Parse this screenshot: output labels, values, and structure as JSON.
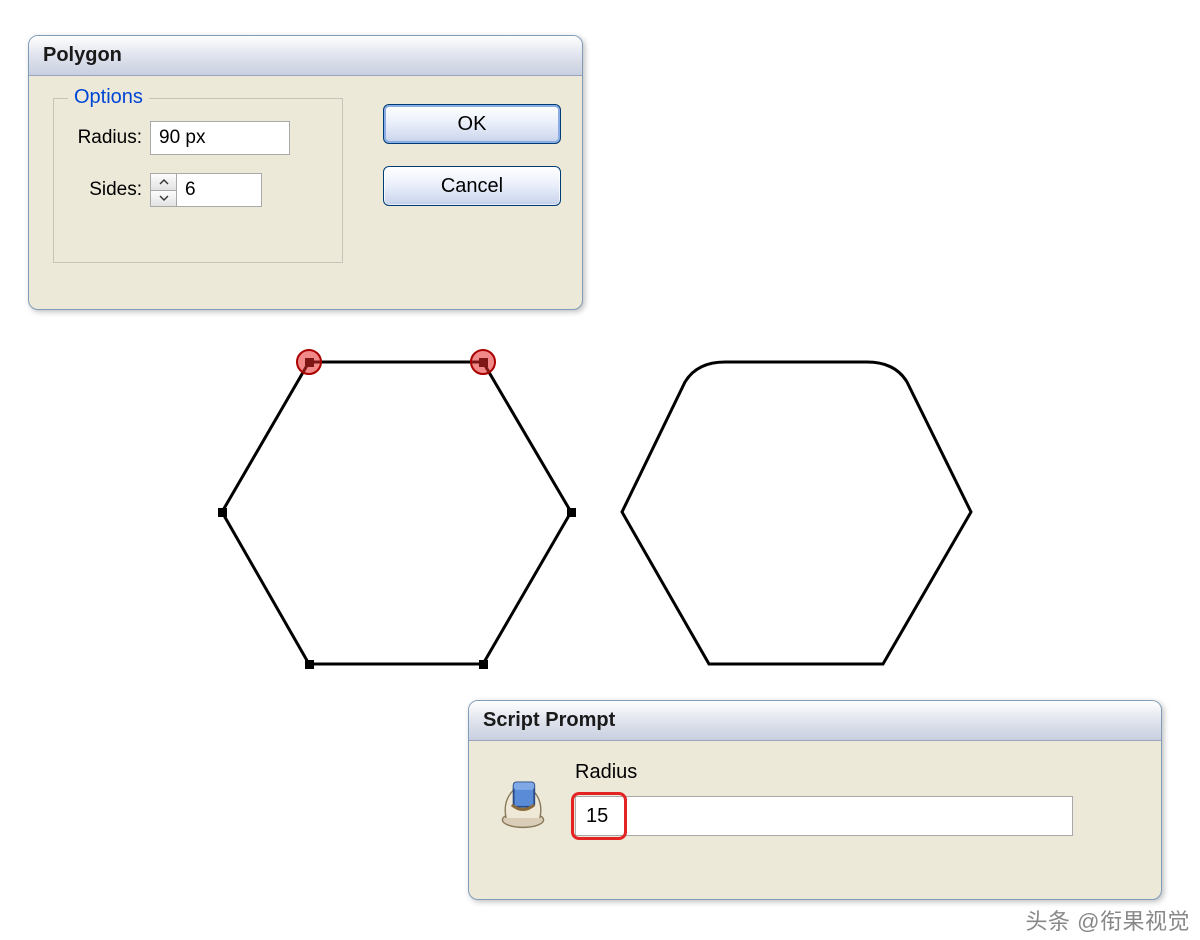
{
  "polygon_dialog": {
    "title": "Polygon",
    "options": {
      "legend": "Options",
      "radius_label": "Radius:",
      "radius_value": "90 px",
      "sides_label": "Sides:",
      "sides_value": "6"
    },
    "buttons": {
      "ok": "OK",
      "cancel": "Cancel"
    }
  },
  "script_dialog": {
    "title": "Script Prompt",
    "field_label": "Radius",
    "field_value": "15",
    "icon": "script-scroll-icon"
  },
  "watermark": "头条 @衔果视觉"
}
